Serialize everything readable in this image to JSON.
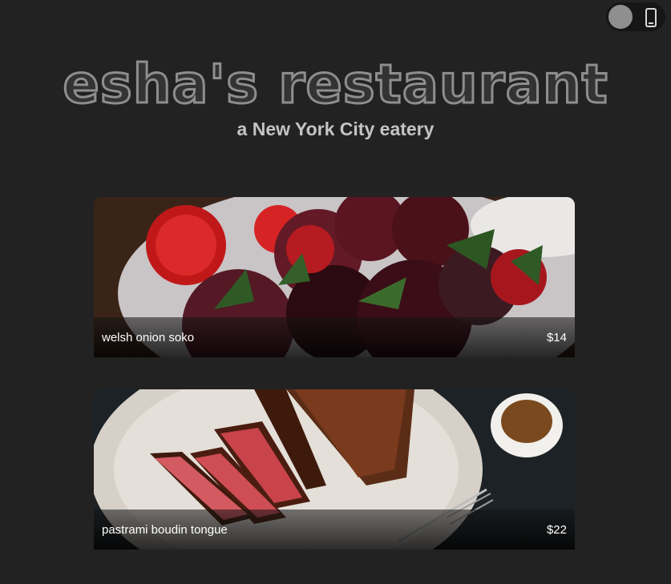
{
  "header": {
    "title": "esha's restaurant",
    "subtitle": "a New York City eatery"
  },
  "toggle": {
    "icon": "mobile-phone-icon",
    "knob_color": "#8f8f8f"
  },
  "menu": {
    "items": [
      {
        "name": "welsh onion soko",
        "price": "$14"
      },
      {
        "name": "pastrami boudin tongue",
        "price": "$22"
      }
    ]
  },
  "colors": {
    "background": "#222222",
    "title_stroke": "#8e8e8e",
    "subtitle": "#c4c4c4"
  }
}
